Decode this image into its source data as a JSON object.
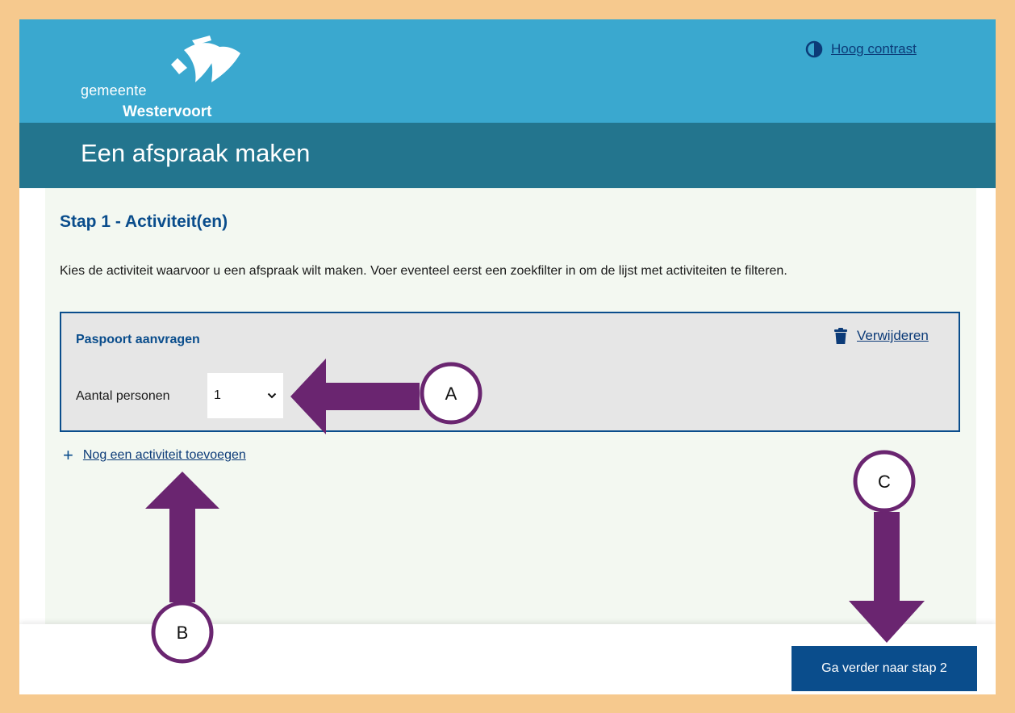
{
  "header": {
    "logo_line1": "gemeente",
    "logo_line2": "Westervoort",
    "contrast_label": "Hoog contrast"
  },
  "page": {
    "title": "Een afspraak maken"
  },
  "step": {
    "heading": "Stap 1 - Activiteit(en)",
    "intro": "Kies de activiteit waarvoor u een afspraak wilt maken. Voer eventeel eerst een zoekfilter in om de lijst met activiteiten te filteren."
  },
  "activity": {
    "name": "Paspoort aanvragen",
    "remove_label": "Verwijderen",
    "persons_label": "Aantal personen",
    "persons_value": "1"
  },
  "add_activity_label": "Nog een activiteit toevoegen",
  "footer": {
    "next_label": "Ga verder naar stap 2"
  },
  "annotations": {
    "a": "A",
    "b": "B",
    "c": "C",
    "arrow_color": "#6a2570"
  },
  "icons": {
    "contrast": "contrast-icon",
    "remove": "trash-icon",
    "add": "plus-icon",
    "select": "chevron-down-icon"
  }
}
